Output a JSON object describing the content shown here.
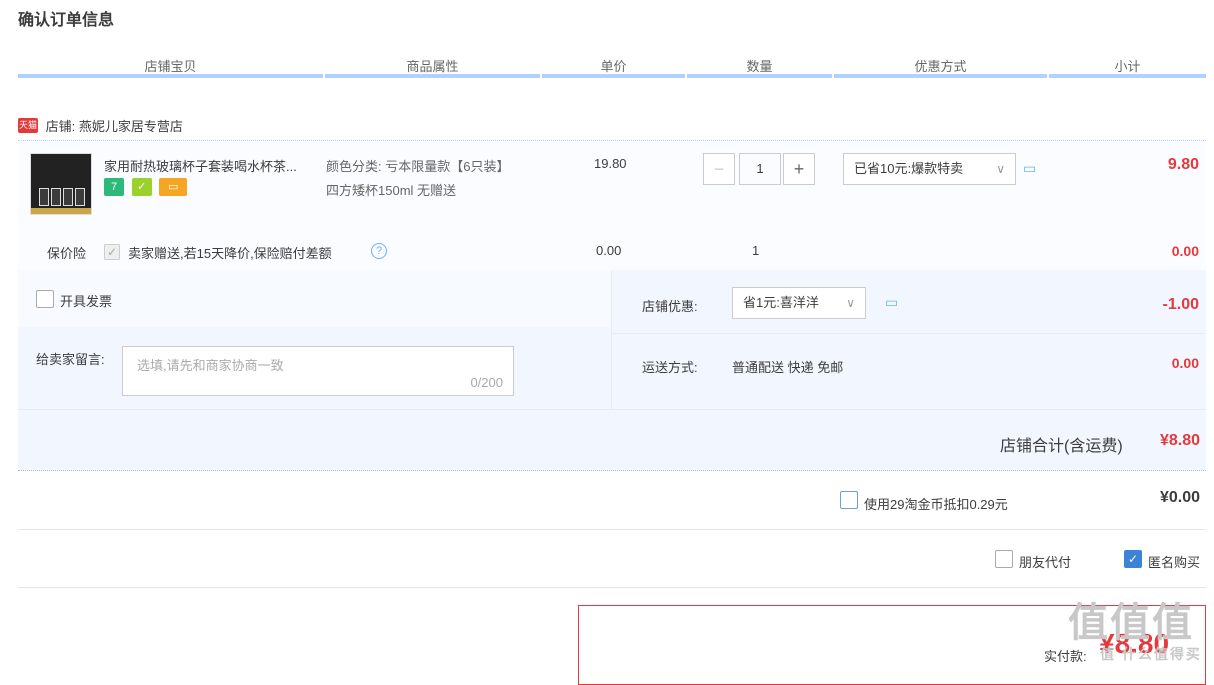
{
  "page_title": "确认订单信息",
  "columns": [
    "店铺宝贝",
    "商品属性",
    "单价",
    "数量",
    "优惠方式",
    "小计"
  ],
  "shop": {
    "badge": "天猫",
    "label": "店铺: 燕妮儿家居专营店"
  },
  "item": {
    "name": "家用耐热玻璃杯子套装喝水杯茶...",
    "badges": [
      "7",
      "✓",
      "▭"
    ],
    "attr_line1": "颜色分类: 亏本限量款【6只装】",
    "attr_line2": "四方矮杯150ml 无赠送",
    "price": "19.80",
    "quantity": "1",
    "promo": "已省10元:爆款特卖",
    "subtotal": "9.80"
  },
  "insurance": {
    "label": "保价险",
    "desc": "卖家赠送,若15天降价,保险赔付差额",
    "price": "0.00",
    "qty": "1",
    "subtotal": "0.00"
  },
  "invoice_label": "开具发票",
  "message": {
    "label": "给卖家留言:",
    "placeholder": "选填,请先和商家协商一致",
    "counter": "0/200"
  },
  "shop_discount": {
    "label": "店铺优惠:",
    "option": "省1元:喜洋洋",
    "amount": "-1.00"
  },
  "shipping": {
    "label": "运送方式:",
    "value": "普通配送 快递 免邮",
    "amount": "0.00"
  },
  "shop_total": {
    "label": "店铺合计(含运费)",
    "amount": "¥8.80"
  },
  "coins": {
    "label": "使用29淘金币抵扣0.29元",
    "amount": "¥0.00"
  },
  "friend_pay": "朋友代付",
  "anonymous": "匿名购买",
  "final": {
    "label": "实付款:",
    "amount": "¥8.80"
  },
  "watermark": "值 什么值得买",
  "colors": {
    "accent": "#e4393c",
    "header_line": "#b2d1ff",
    "checkbox": "#3b82d9"
  }
}
